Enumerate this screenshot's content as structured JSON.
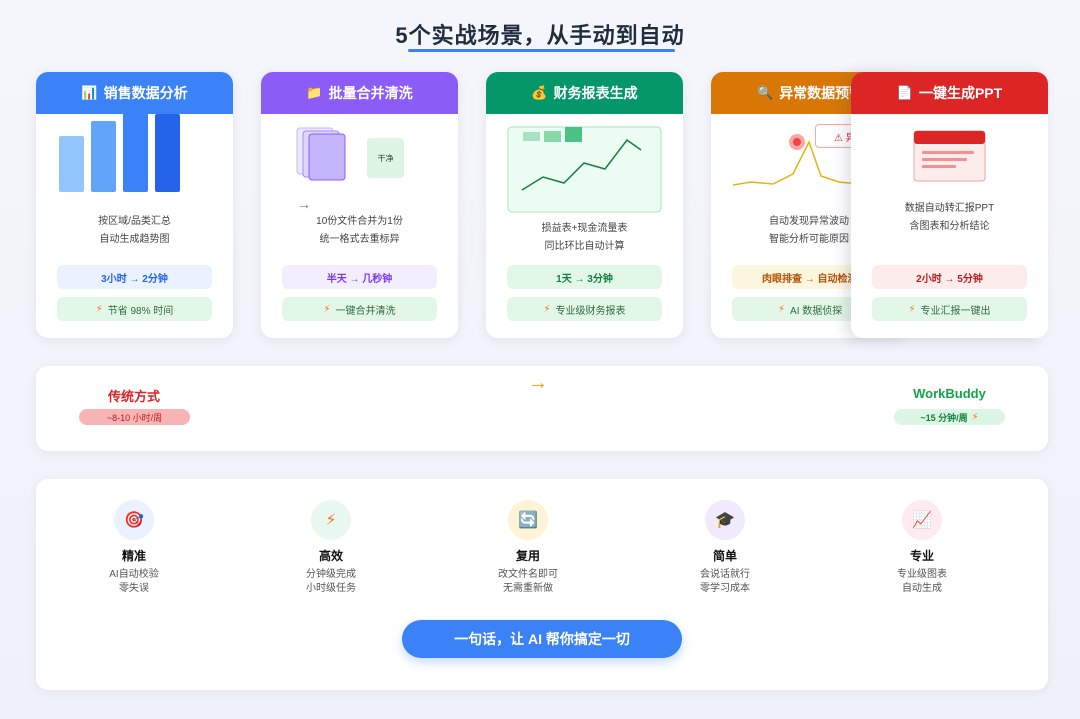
{
  "page": {
    "title": "5个实战场景，从手动到自动"
  },
  "cards": [
    {
      "title": "销售数据分析",
      "icon": "chart-icon",
      "desc1": "按区域/品类汇总",
      "desc2": "自动生成趋势图",
      "time": "3小时 → 2分钟",
      "benefit": "节省 98% 时间",
      "color": "#3b82f6"
    },
    {
      "title": "批量合并清洗",
      "icon": "folder-icon",
      "desc1": "10份文件合并为1份",
      "desc2": "统一格式去重标异",
      "time": "半天 → 几秒钟",
      "benefit": "一键合并清洗",
      "illustration_label": "干净",
      "color": "#8b5cf6"
    },
    {
      "title": "财务报表生成",
      "icon": "money-bag-icon",
      "desc1": "损益表+现金流量表",
      "desc2": "同比环比自动计算",
      "time": "1天 → 3分钟",
      "benefit": "专业级财务报表",
      "color": "#059669"
    },
    {
      "title": "异常数据预警",
      "icon": "magnifier-icon",
      "desc1": "自动发现异常波动",
      "desc2": "智能分析可能原因",
      "time": "肉眼排查 → 自动检测",
      "benefit": "AI 数据侦探",
      "illustration_label": "⚠ 异",
      "color": "#d97706"
    },
    {
      "title": "一键生成PPT",
      "icon": "document-icon",
      "desc1": "数据自动转汇报PPT",
      "desc2": "含图表和分析结论",
      "time": "2小时 → 5分钟",
      "benefit": "专业汇报一键出",
      "color": "#dc2626"
    }
  ],
  "comparison": {
    "left_title": "传统方式",
    "left_value": "~8-10 小时/周",
    "arrow": "→",
    "right_title": "WorkBuddy",
    "right_value": "~15 分钟/周",
    "right_icon": "bolt-icon"
  },
  "features": [
    {
      "name": "精准",
      "line1": "AI自动校验",
      "line2": "零失误",
      "icon": "target-icon",
      "glyph": "🎯",
      "bg": "#eaf2ff"
    },
    {
      "name": "高效",
      "line1": "分钟级完成",
      "line2": "小时级任务",
      "icon": "bolt-icon",
      "glyph": "⚡",
      "bg": "#e8f8ee"
    },
    {
      "name": "复用",
      "line1": "改文件名即可",
      "line2": "无需重新做",
      "icon": "refresh-icon",
      "glyph": "🔄",
      "bg": "#fdf3d6"
    },
    {
      "name": "简单",
      "line1": "会说话就行",
      "line2": "零学习成本",
      "icon": "graduation-cap-icon",
      "glyph": "🎓",
      "bg": "#efeafc"
    },
    {
      "name": "专业",
      "line1": "专业级图表",
      "line2": "自动生成",
      "icon": "chart-up-icon",
      "glyph": "📈",
      "bg": "#fdebef"
    }
  ],
  "cta": {
    "label": "一句话，让 AI 帮你搞定一切"
  }
}
